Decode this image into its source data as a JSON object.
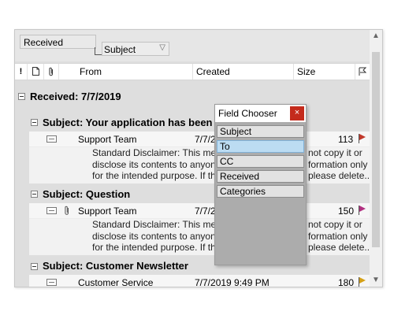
{
  "group_panel": {
    "group_box_label": "Received",
    "second_group_label": "Subject"
  },
  "columns": [
    {
      "label": "",
      "icon": "importance-icon"
    },
    {
      "label": "",
      "icon": "document-icon"
    },
    {
      "label": "",
      "icon": "attachment-icon"
    },
    {
      "label": "From"
    },
    {
      "label": "Created"
    },
    {
      "label": "Size"
    },
    {
      "label": "",
      "icon": "flag-filter-icon"
    }
  ],
  "outer_group": {
    "label": "Received: 7/7/2019"
  },
  "groups": [
    {
      "label": "Subject: Your application has been app",
      "rows": [
        {
          "from": "Support Team",
          "created": "7/7/2",
          "size": "113",
          "flag_color": "#c0392b",
          "attachment": false,
          "down_arrow": false,
          "preview": [
            "Standard Disclaimer: This message is",
            "disclose its contents to anyone. You r",
            "for the intended purpose. If this email"
          ],
          "preview_right": [
            "not copy it or",
            "formation only",
            "please delete..."
          ]
        }
      ]
    },
    {
      "label": "Subject: Question",
      "rows": [
        {
          "from": "Support Team",
          "created": "7/7/2",
          "size": "150",
          "flag_color": "#b03080",
          "attachment": true,
          "down_arrow": false,
          "preview": [
            "Standard Disclaimer: This message is",
            "disclose its contents to anyone. You r",
            "for the intended purpose. If this email"
          ],
          "preview_right": [
            "not copy it or",
            "formation only",
            "please delete..."
          ]
        }
      ]
    },
    {
      "label": "Subject: Customer Newsletter",
      "rows": [
        {
          "from": "Customer Service",
          "created": "7/7/2019 9:49 PM",
          "size": "180",
          "flag_color": "#d4a017",
          "attachment": false,
          "down_arrow": true
        }
      ]
    }
  ],
  "field_chooser": {
    "title": "Field Chooser",
    "close_glyph": "×",
    "items": [
      "Subject",
      "To",
      "CC",
      "Received",
      "Categories"
    ],
    "selected": "To"
  },
  "scrollbar": {
    "up_glyph": "▲",
    "down_glyph": "▼"
  }
}
